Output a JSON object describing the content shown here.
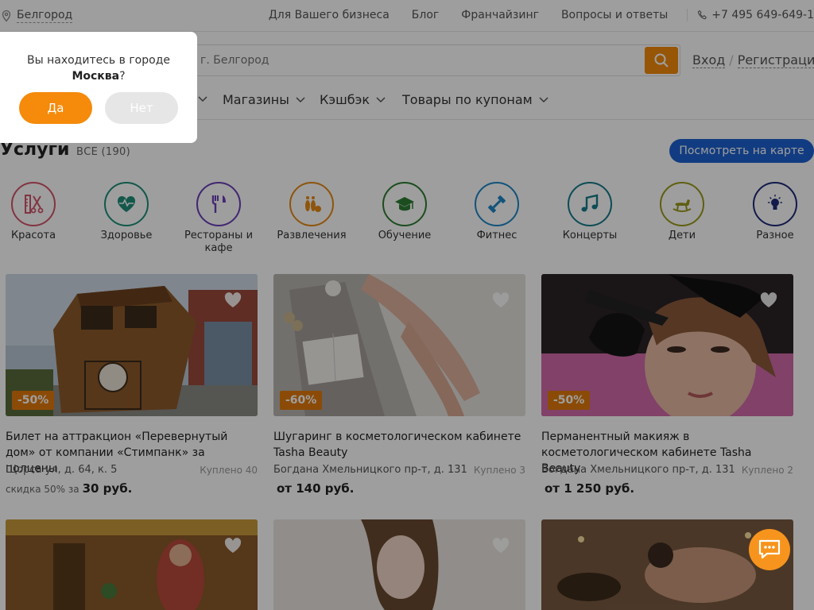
{
  "topbar": {
    "city": "Белгород",
    "links": [
      "Для Вашего бизнеса",
      "Блог",
      "Франчайзинг",
      "Вопросы и ответы"
    ],
    "phone": "+7 495 649-649-1"
  },
  "search": {
    "placeholder": "г. Белгород"
  },
  "auth": {
    "login": "Вход",
    "register": "Регистрация"
  },
  "catnav": {
    "items": [
      "Магазины",
      "Кэшбэк",
      "Товары по купонам"
    ]
  },
  "section": {
    "title": "Услуги",
    "count": "ВСЕ (190)",
    "map_button": "Посмотреть на карте"
  },
  "services": [
    {
      "label": "Красота",
      "icon": "scissors-comb-icon",
      "color": "#d4546a"
    },
    {
      "label": "Здоровье",
      "icon": "heart-pulse-icon",
      "color": "#1f8f7a"
    },
    {
      "label": "Рестораны и кафе",
      "icon": "fork-knife-icon",
      "color": "#6b3fb8"
    },
    {
      "label": "Развлечения",
      "icon": "bowling-icon",
      "color": "#e58a14"
    },
    {
      "label": "Обучение",
      "icon": "graduation-cap-icon",
      "color": "#2e7d32"
    },
    {
      "label": "Фитнес",
      "icon": "dumbbell-icon",
      "color": "#1f86c7"
    },
    {
      "label": "Концерты",
      "icon": "music-note-icon",
      "color": "#167b8a"
    },
    {
      "label": "Дети",
      "icon": "rocking-horse-icon",
      "color": "#9a9a1c"
    },
    {
      "label": "Разное",
      "icon": "lightbulb-icon",
      "color": "#1d2a7a"
    }
  ],
  "cards": [
    {
      "discount": "-50%",
      "title": "Билет на аттракцион «Перевернутый дом» от компании «Стимпанк» за полцены",
      "address": "Щорса ул, д. 64, к. 5",
      "bought": "Куплено 40",
      "price_prefix": "скидка 50% за",
      "price": "30 руб."
    },
    {
      "discount": "-60%",
      "title": "Шугаринг в косметологическом кабинете Tasha Beauty",
      "address": "Богдана Хмельницкого пр-т, д. 131",
      "bought": "Куплено 3",
      "price_prefix": "",
      "price": "от 140 руб."
    },
    {
      "discount": "-50%",
      "title": "Перманентный макияж в косметологическом кабинете Tasha Beauty",
      "address": "Богдана Хмельницкого пр-т, д. 131",
      "bought": "Куплено 2",
      "price_prefix": "",
      "price": "от 1 250 руб."
    }
  ],
  "popup": {
    "question": "Вы находитесь в городе",
    "city": "Москва",
    "suffix": "?",
    "yes": "Да",
    "no": "Нет"
  },
  "colors": {
    "accent": "#f48a0a",
    "map_button": "#1e62d0",
    "discount": "#e07a0c"
  }
}
